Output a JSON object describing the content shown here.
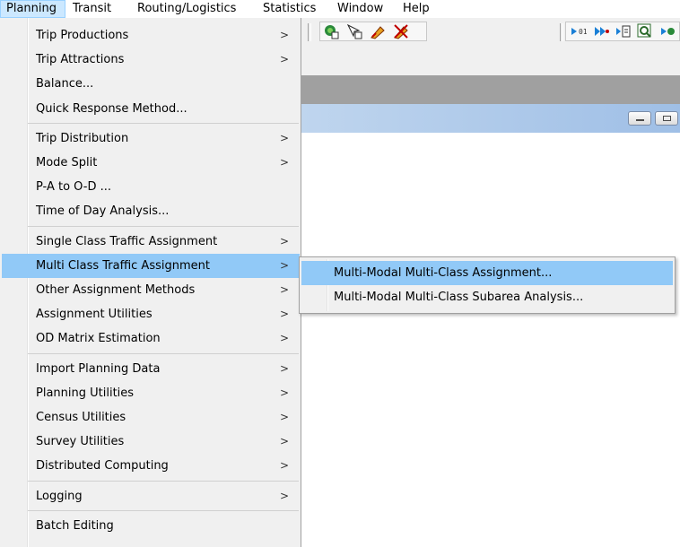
{
  "menubar": {
    "items": [
      {
        "label": "Planning",
        "active": true
      },
      {
        "label": "Transit"
      },
      {
        "label": "Routing/Logistics"
      },
      {
        "label": "Statistics"
      },
      {
        "label": "Window"
      },
      {
        "label": "Help"
      }
    ]
  },
  "planning_menu": {
    "groups": [
      [
        {
          "label": "Trip Productions",
          "submenu": true
        },
        {
          "label": "Trip Attractions",
          "submenu": true
        },
        {
          "label": "Balance...",
          "submenu": false
        },
        {
          "label": "Quick Response Method...",
          "submenu": false
        }
      ],
      [
        {
          "label": "Trip Distribution",
          "submenu": true
        },
        {
          "label": "Mode Split",
          "submenu": true
        },
        {
          "label": "P-A to O-D ...",
          "submenu": false
        },
        {
          "label": "Time of Day Analysis...",
          "submenu": false
        }
      ],
      [
        {
          "label": "Single Class Traffic Assignment",
          "submenu": true
        },
        {
          "label": "Multi Class Traffic Assignment",
          "submenu": true,
          "highlighted": true
        },
        {
          "label": "Other Assignment Methods",
          "submenu": true
        },
        {
          "label": "Assignment Utilities",
          "submenu": true
        },
        {
          "label": "OD Matrix Estimation",
          "submenu": true
        }
      ],
      [
        {
          "label": "Import Planning Data",
          "submenu": true
        },
        {
          "label": "Planning Utilities",
          "submenu": true
        },
        {
          "label": "Census Utilities",
          "submenu": true
        },
        {
          "label": "Survey Utilities",
          "submenu": true
        },
        {
          "label": "Distributed Computing",
          "submenu": true
        }
      ],
      [
        {
          "label": "Logging",
          "submenu": true
        }
      ],
      [
        {
          "label": "Batch Editing",
          "submenu": false
        }
      ]
    ],
    "arrow_glyph": ">"
  },
  "submenu": {
    "items": [
      {
        "label": "Multi-Modal Multi-Class Assignment...",
        "highlighted": true
      },
      {
        "label": "Multi-Modal Multi-Class Subarea Analysis..."
      }
    ]
  },
  "colors": {
    "menu_bg": "#f0f0f0",
    "highlight": "#91c9f7",
    "menubar_active": "#cce8ff",
    "mdi_title": "#bfd5ee",
    "workspace_gray": "#a0a0a0"
  }
}
